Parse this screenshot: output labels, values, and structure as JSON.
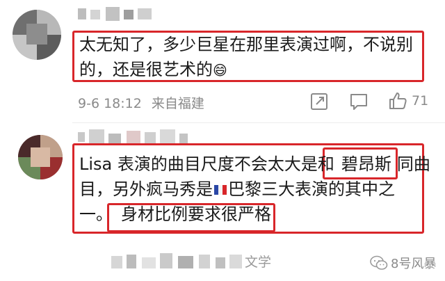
{
  "comment1": {
    "line1": "太无知了，多少巨星在那里表演过啊，不说别",
    "line2": "的，还是很艺术的",
    "emoji": "😄",
    "time": "9-6 18:12",
    "location": "来自福建",
    "likes": "71"
  },
  "comment2": {
    "line1_a": "Lisa 表演的曲目尺度不会太大是和",
    "line1_b": "碧昂斯",
    "line1_c": "同曲",
    "line2_a": "目，另外疯马秀是",
    "line2_b": "巴黎三大表演的其中之",
    "line3_a": "一。",
    "line3_b": "身材比例要求很严格",
    "footer_partial": "文学"
  },
  "watermark": {
    "label": "8号风暴"
  },
  "colors": {
    "highlight_red": "#d8262a",
    "text": "#1a1a1a",
    "meta": "#8a8a8a"
  },
  "icons": [
    "share-icon",
    "comment-icon",
    "like-icon",
    "flag-icon",
    "wechat-icon"
  ]
}
